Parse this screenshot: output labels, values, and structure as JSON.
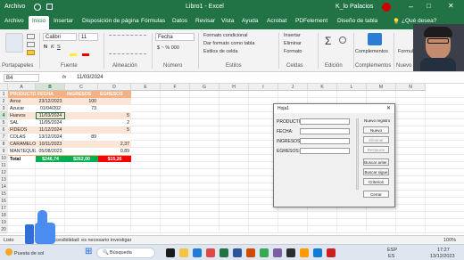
{
  "window": {
    "autosave_label": "Archivo",
    "title": "Libro1 - Excel",
    "user": "K_lo Palacios",
    "tell_me": "¿Qué desea?"
  },
  "tabs": [
    "Archivo",
    "Inicio",
    "Insertar",
    "Disposición de página",
    "Fórmulas",
    "Datos",
    "Revisar",
    "Vista",
    "Ayuda",
    "Acrobat",
    "PDFelement",
    "Diseño de tabla"
  ],
  "ribbon": {
    "font_name": "Calibri",
    "font_size": "11",
    "number_format": "Fecha",
    "cond_format": "Formato condicional",
    "table_format": "Dar formato como tabla",
    "cell_styles": "Estilos de celda",
    "insert": "Insertar",
    "delete": "Eliminar",
    "format": "Formato",
    "addins": "Complementos",
    "groups": [
      "Portapapeles",
      "Fuente",
      "Alineación",
      "Número",
      "Estilos",
      "Celdas",
      "Edición",
      "Complementos",
      "Nuevo grupo"
    ]
  },
  "formula_bar": {
    "name_box": "B4",
    "fx": "fx",
    "value": "11/03/2024"
  },
  "grid": {
    "columns": [
      "A",
      "B",
      "C",
      "D",
      "E",
      "F",
      "G",
      "H",
      "I",
      "J",
      "K",
      "L",
      "M",
      "N"
    ],
    "headers": [
      "PRODUCTO",
      "FECHA",
      "INGRESOS",
      "EGRESOS"
    ],
    "rows": [
      [
        "Arroz",
        "23/12/2023",
        "100",
        ""
      ],
      [
        "Azucar",
        "01/04/202",
        "73",
        ""
      ],
      [
        "Huevos",
        "11/03/2024",
        "",
        "5"
      ],
      [
        "SAL",
        "11/05/2024",
        "",
        "2"
      ],
      [
        "FIDEOS",
        "11/12/2024",
        "",
        "5"
      ],
      [
        "COLAS",
        "13/12/2024",
        "89",
        ""
      ],
      [
        "CARAMELOS",
        "10/11/2023",
        "",
        "2,37"
      ],
      [
        "MANTEQUILLA",
        "05/08/2023",
        "",
        "0,89"
      ]
    ],
    "total": [
      "Total",
      "$246,74",
      "$262,00",
      "$15,26"
    ],
    "row_numbers": [
      "1",
      "2",
      "3",
      "4",
      "5",
      "6",
      "7",
      "8",
      "9",
      "10",
      "11",
      "12",
      "13",
      "14",
      "15",
      "16",
      "17",
      "18",
      "19",
      "20"
    ]
  },
  "form": {
    "title": "Hoja1",
    "labels": [
      "PRODUCTO:",
      "FECHA:",
      "INGRESOS:",
      "EGRESOS:"
    ],
    "section": "Nuevo registro",
    "buttons": [
      "Nuevo",
      "Eliminar",
      "Restaurar",
      "Buscar anter.",
      "Buscar sigue",
      "Criterios",
      "Cerrar"
    ]
  },
  "status": {
    "mode": "Listo",
    "accessibility": "Accesibilidad: es necesario investigar",
    "zoom": "100%"
  },
  "taskbar": {
    "weather": "Puesta de sol",
    "search": "Búsqueda",
    "lang": "ESP",
    "layout": "ES",
    "time": "17:27",
    "date": "13/12/2023"
  },
  "colors": {
    "excel_green": "#217346",
    "header_orange": "#f4b183",
    "total_green": "#00b050",
    "total_red": "#ff0000"
  }
}
